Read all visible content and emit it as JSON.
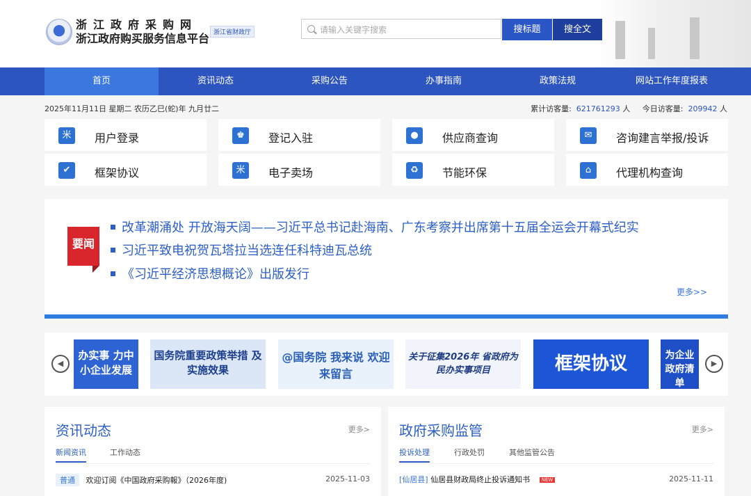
{
  "header": {
    "site_name": "浙江政府采购网",
    "platform_name": "浙江政府购买服务信息平台",
    "badge": "浙江省财政厅",
    "search_placeholder": "请输入关键字搜索",
    "btn_search_title": "搜标题",
    "btn_search_full": "搜全文"
  },
  "nav": [
    "首页",
    "资讯动态",
    "采购公告",
    "办事指南",
    "政策法规",
    "网站工作年度报表"
  ],
  "info": {
    "date": "2025年11月11日 星期二 农历乙巳(蛇)年 九月廿二",
    "total_label": "累计访客量:",
    "total_value": "621761293",
    "total_unit": "人",
    "today_label": "今日访客量:",
    "today_value": "209942",
    "today_unit": "人"
  },
  "quick_links": [
    {
      "label": "用户登录",
      "icon": "user-login-icon",
      "glyph": "米"
    },
    {
      "label": "登记入驻",
      "icon": "register-icon",
      "glyph": "♚"
    },
    {
      "label": "供应商查询",
      "icon": "supplier-query-icon",
      "glyph": "●"
    },
    {
      "label": "咨询建言举报/投诉",
      "icon": "complaint-icon",
      "glyph": "✉"
    },
    {
      "label": "框架协议",
      "icon": "framework-icon",
      "glyph": "✔"
    },
    {
      "label": "电子卖场",
      "icon": "emall-icon",
      "glyph": "米"
    },
    {
      "label": "节能环保",
      "icon": "eco-icon",
      "glyph": "♻"
    },
    {
      "label": "代理机构查询",
      "icon": "agency-icon",
      "glyph": "⌂"
    }
  ],
  "news": {
    "tag": "要闻",
    "items": [
      "改革潮涌处 开放海天阔——习近平总书记赴海南、广东考察并出席第十五届全运会开幕式纪实",
      "习近平致电祝贺瓦塔拉当选连任科特迪瓦总统",
      "《习近平经济思想概论》出版发行"
    ],
    "more": "更多>>"
  },
  "banners": [
    {
      "text": "办实事 力中小企业发展"
    },
    {
      "text": "国务院重要政策举措 及实施效果"
    },
    {
      "text": "@国务院 我来说 欢迎来留言"
    },
    {
      "text": "关于征集2026年 省政府为民办实事项目"
    },
    {
      "text": "框架协议"
    },
    {
      "text": "为企业 政府清单"
    }
  ],
  "panel_news": {
    "title": "资讯动态",
    "more": "更多>",
    "tabs": [
      "新闻资讯",
      "工作动态"
    ],
    "rows": [
      {
        "tag": "普通",
        "text": "欢迎订阅《中国政府采购報》（2026年度)",
        "date": "2025-11-03"
      }
    ]
  },
  "panel_supervise": {
    "title": "政府采购监管",
    "more": "更多>",
    "tabs": [
      "投诉处理",
      "行政处罚",
      "其他监管公告"
    ],
    "rows": [
      {
        "tag": "[仙居县]",
        "text": "仙居县财政局终止投诉通知书",
        "badge": "NEW",
        "date": "2025-11-11"
      }
    ]
  }
}
